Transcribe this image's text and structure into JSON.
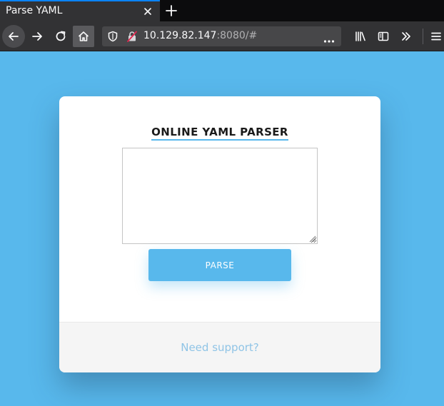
{
  "browser": {
    "tab": {
      "title": "Parse YAML"
    },
    "url": {
      "host": "10.129.82.147",
      "rest": ":8080/#"
    }
  },
  "icons": {
    "back": "arrow-left-icon",
    "forward": "arrow-right-icon",
    "reload": "reload-icon",
    "home": "home-icon",
    "tracking": "shield-icon",
    "insecure": "insecure-lock-icon",
    "more": "ellipsis-icon",
    "library": "library-icon",
    "sidebar": "sidebar-icon",
    "overflow": "chevron-double-right-icon",
    "menu": "hamburger-menu-icon"
  },
  "colors": {
    "page_background": "#58b8ec",
    "accent": "#58b8ec",
    "link": "#8fc4e6"
  },
  "page": {
    "title": "ONLINE YAML PARSER",
    "input": {
      "value": "",
      "placeholder": ""
    },
    "parse_label": "PARSE",
    "support_label": "Need support?"
  }
}
